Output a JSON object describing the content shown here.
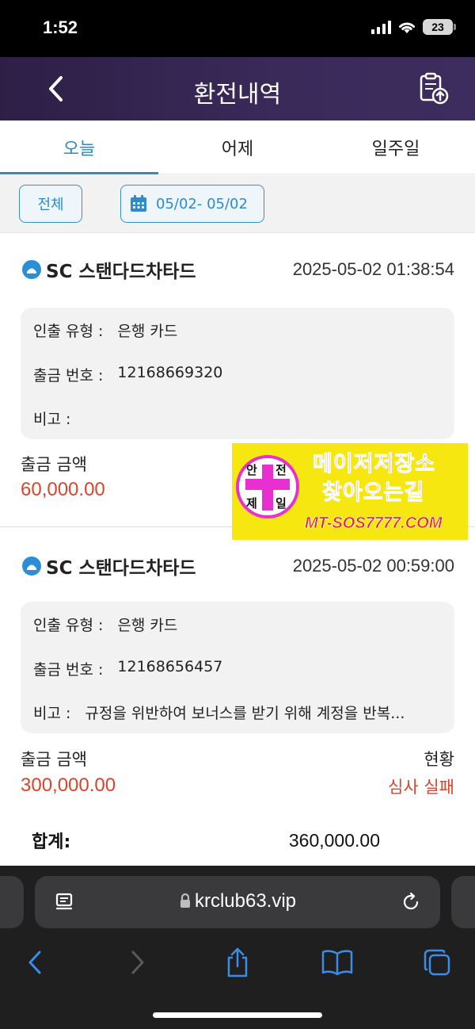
{
  "status_bar": {
    "time": "1:52",
    "battery": "23"
  },
  "header": {
    "title": "환전내역"
  },
  "tabs": [
    {
      "label": "오늘",
      "active": true
    },
    {
      "label": "어제",
      "active": false
    },
    {
      "label": "일주일",
      "active": false
    }
  ],
  "filter": {
    "all_label": "전체",
    "date_range": "05/02- 05/02"
  },
  "records": [
    {
      "bank": "SC 스탠다드차타드",
      "datetime": "2025-05-02 01:38:54",
      "type_label": "인출 유형 :",
      "type_value": "은행 카드",
      "number_label": "출금 번호 :",
      "number_value": "12168669320",
      "note_label": "비고 :",
      "note_value": "",
      "amount_label": "출금 금액",
      "amount_value": "60,000.00"
    },
    {
      "bank": "SC 스탠다드차타드",
      "datetime": "2025-05-02 00:59:00",
      "type_label": "인출 유형 :",
      "type_value": "은행 카드",
      "number_label": "출금 번호 :",
      "number_value": "12168656457",
      "note_label": "비고 :",
      "note_value": "규정을 위반하여 보너스를 받기 위해 계정을 반복...",
      "amount_label": "출금 금액",
      "amount_value": "300,000.00",
      "status_label": "현황",
      "status_value": "심사 실패"
    }
  ],
  "total": {
    "label": "합계:",
    "value": "360,000.00"
  },
  "ad": {
    "line1": "메이저저장소",
    "line2": "찾아오는길",
    "url": "MT-SOS7777.COM",
    "badge_chars": [
      "안",
      "전",
      "제",
      "일"
    ],
    "colors": {
      "background": "#f7e710",
      "accent": "#e82fcf",
      "text": "#e8212a"
    }
  },
  "browser": {
    "url": "krclub63.vip"
  },
  "colors": {
    "accent": "#2e8bc9",
    "amount": "#d9442b",
    "header_bg": "#2d1f46"
  }
}
